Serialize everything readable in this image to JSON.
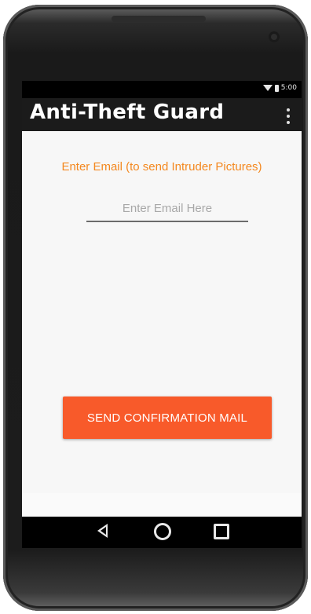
{
  "status_bar": {
    "time": "5:00",
    "wifi_icon": "wifi-icon",
    "battery_icon": "battery-icon"
  },
  "app_bar": {
    "title": "Anti-Theft Guard",
    "menu_icon": "overflow-menu-icon"
  },
  "form": {
    "prompt": "Enter Email (to send Intruder Pictures)",
    "email_placeholder": "Enter Email Here",
    "email_value": "",
    "send_label": "SEND CONFIRMATION MAIL"
  },
  "nav_bar": {
    "back_icon": "back-icon",
    "home_icon": "home-icon",
    "recents_icon": "recents-icon"
  },
  "colors": {
    "accent": "#f4881f",
    "button": "#f85a2a",
    "app_bar": "#1b1b1b",
    "background": "#fafafa"
  }
}
